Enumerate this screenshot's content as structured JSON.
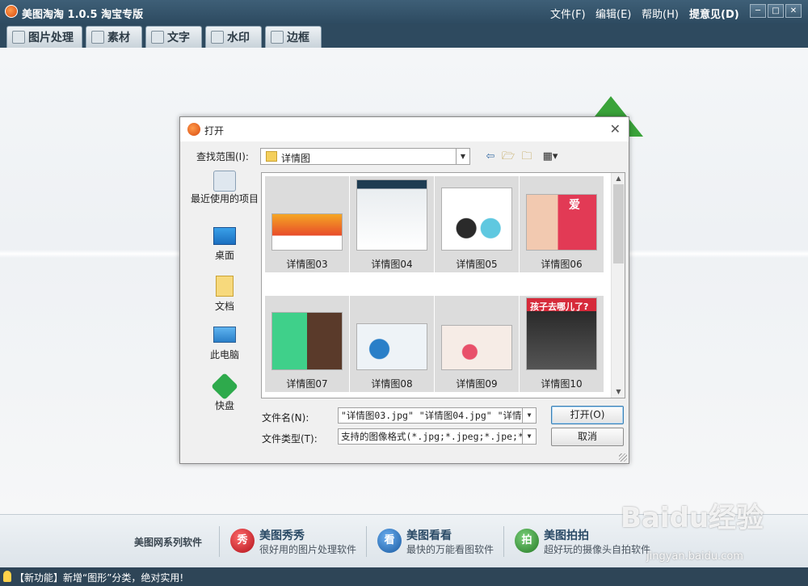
{
  "app": {
    "title": "美图淘淘 1.0.5 淘宝专版",
    "menu": [
      "文件(F)",
      "编辑(E)",
      "帮助(H)",
      "提意见(D)"
    ],
    "window_buttons": [
      "minimize",
      "restore",
      "close"
    ]
  },
  "tabs": [
    "图片处理",
    "素材",
    "文字",
    "水印",
    "边框"
  ],
  "dialog": {
    "title": "打开",
    "look_in_label": "查找范围(I):",
    "look_in_value": "详情图",
    "places": [
      "最近使用的项目",
      "桌面",
      "文档",
      "此电脑",
      "快盘"
    ],
    "files": [
      "详情图03",
      "详情图04",
      "详情图05",
      "详情图06",
      "详情图07",
      "详情图08",
      "详情图09",
      "详情图10"
    ],
    "thumbnail_texts": {
      "t06": "爱",
      "t10": "孩子去哪儿了?"
    },
    "filename_label": "文件名(N):",
    "filename_value": "\"详情图03.jpg\" \"详情图04.jpg\" \"详情图0",
    "filetype_label": "文件类型(T):",
    "filetype_value": "支持的图像格式(*.jpg;*.jpeg;*.jpe;*.j",
    "open_button": "打开(O)",
    "cancel_button": "取消"
  },
  "promo": {
    "label": "美图网系列软件",
    "items": [
      {
        "icon": "秀",
        "title": "美图秀秀",
        "subtitle": "很好用的图片处理软件",
        "color": "#c8202a"
      },
      {
        "icon": "看",
        "title": "美图看看",
        "subtitle": "最快的万能看图软件",
        "color": "#2a6fb8"
      },
      {
        "icon": "拍",
        "title": "美图拍拍",
        "subtitle": "超好玩的摄像头自拍软件",
        "color": "#3a9a3a"
      }
    ]
  },
  "status": "【新功能】新增“图形”分类，绝对实用!",
  "watermark": {
    "text": "Baidu经验",
    "url": "jingyan.baidu.com"
  }
}
